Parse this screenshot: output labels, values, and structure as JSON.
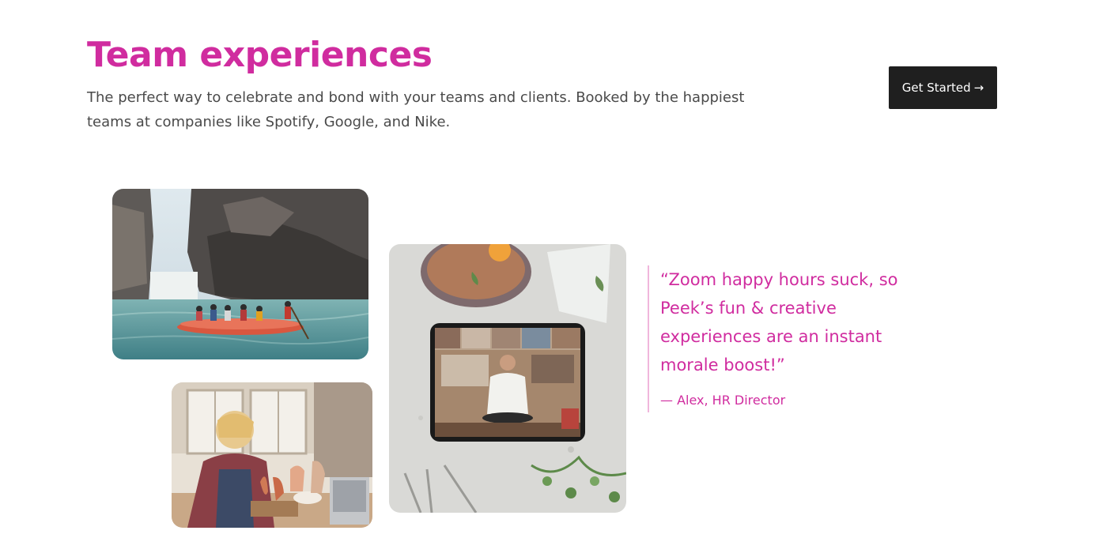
{
  "hero": {
    "title": "Team experiences",
    "subtitle": "The perfect way to celebrate and bond with your teams and clients. Booked by the happiest teams at companies like Spotify, Google, and Nike.",
    "cta_label": "Get Started",
    "cta_arrow": "→"
  },
  "testimonial": {
    "quote": "“Zoom happy hours suck, so Peek’s fun & creative experiences are an instant morale boost!”",
    "author": "— Alex, HR Director"
  },
  "photos": [
    {
      "name": "rafting-photo",
      "subject": "river rafting"
    },
    {
      "name": "cooking-class-photo",
      "subject": "virtual cooking class on tablet"
    },
    {
      "name": "pottery-photo",
      "subject": "pottery workshop"
    }
  ],
  "colors": {
    "brand_pink": "#d02c9f",
    "button_dark": "#1f1f1f",
    "body_text": "#4a4a4a",
    "quote_rule": "#f0b6dc"
  }
}
